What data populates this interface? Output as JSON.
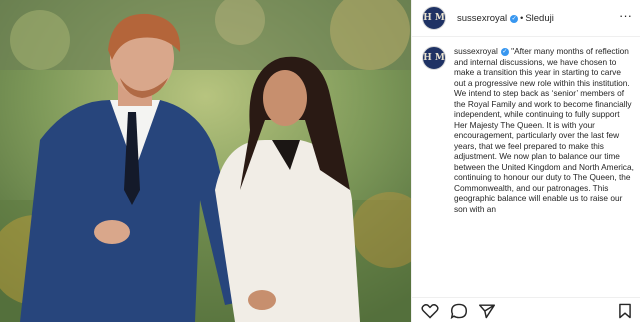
{
  "post": {
    "username": "sussexroyal",
    "separator": "•",
    "follow_label": "Sleduji",
    "avatar_monogram": "H M",
    "caption": "\"After many months of reflection and internal discussions, we have chosen to make a transition this year in starting to carve out a progressive new role within this institution. We intend to step back as ‘senior’ members of the Royal Family and work to become financially independent, while continuing to fully support Her Majesty The Queen. It is with your encouragement, particularly over the last few years, that we feel prepared to make this adjustment. We now plan to balance our time between the United Kingdom and North America, continuing to honour our duty to The Queen, the Commonwealth, and our patronages. This geographic balance will enable us to raise our son with an"
  },
  "icons": {
    "verified": "verified-badge-icon",
    "more": "more-options-icon",
    "like": "heart-icon",
    "comment": "comment-icon",
    "share": "share-icon",
    "save": "bookmark-icon"
  },
  "colors": {
    "avatar_bg": "#1f3264",
    "verified": "#3897f0",
    "text": "#262626"
  }
}
